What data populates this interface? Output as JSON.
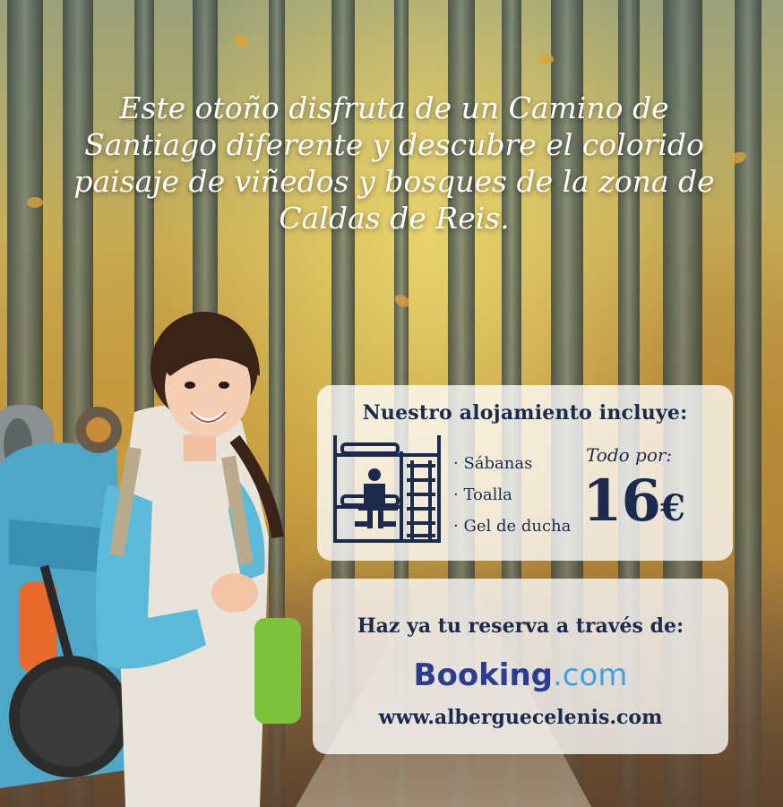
{
  "headline": "Este otoño disfruta de un Camino de Santiago diferente y descubre el colorido paisaje de viñedos y bosques de la zona de Caldas de Reis.",
  "amenities": {
    "title": "Nuestro alojamiento incluye:",
    "items": [
      "Sábanas",
      "Toalla",
      "Gel de ducha"
    ]
  },
  "price": {
    "label": "Todo por:",
    "amount": "16",
    "currency": "€"
  },
  "booking": {
    "title": "Haz ya tu reserva a través de:",
    "logo_main": "Booking",
    "logo_suffix": ".com",
    "url": "www.alberguecelenis.com"
  },
  "colors": {
    "navy": "#1c2a4e",
    "booking_blue": "#2b3d8f",
    "booking_light_blue": "#3aa3e6",
    "jacket_teal": "#5bbad8"
  },
  "icons": [
    "bunk-bed-icon"
  ]
}
